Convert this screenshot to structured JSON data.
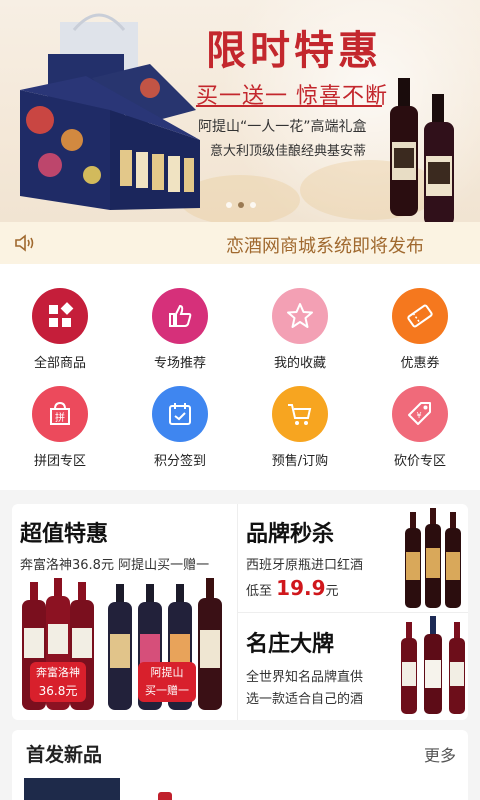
{
  "banner": {
    "title": "限时特惠",
    "subtitle": "买一送一 惊喜不断",
    "line2": "阿提山“一人一花”高端礼盒",
    "line3": "意大利顶级佳酿经典基安蒂"
  },
  "notice": {
    "text": "恋酒网商城系统即将发布",
    "icon": "speaker-icon"
  },
  "menu": [
    {
      "label": "全部商品",
      "icon": "grid-icon",
      "color": "#c51e3a"
    },
    {
      "label": "专场推荐",
      "icon": "thumbs-up-icon",
      "color": "#d6307a"
    },
    {
      "label": "我的收藏",
      "icon": "star-icon",
      "color": "#f3a0b4"
    },
    {
      "label": "优惠券",
      "icon": "coupon-icon",
      "color": "#f5781e"
    },
    {
      "label": "拼团专区",
      "icon": "group-buy-icon",
      "color": "#ec4a5c"
    },
    {
      "label": "积分签到",
      "icon": "calendar-icon",
      "color": "#3f86f0"
    },
    {
      "label": "预售/订购",
      "icon": "cart-icon",
      "color": "#f7a520"
    },
    {
      "label": "砍价专区",
      "icon": "price-tag-icon",
      "color": "#f06a7a"
    }
  ],
  "promo": {
    "left": {
      "title": "超值特惠",
      "sub": "奔富洛神36.8元 阿提山买一赠一",
      "tag1_line1": "奔富洛神",
      "tag1_line2": "36.8元",
      "tag2_line1": "阿提山",
      "tag2_line2": "买一赠一"
    },
    "right_top": {
      "title": "品牌秒杀",
      "sub": "西班牙原瓶进口红酒",
      "price_prefix": "低至",
      "price": "19.9",
      "price_suffix": "元"
    },
    "right_bottom": {
      "title": "名庄大牌",
      "sub1": "全世界知名品牌直供",
      "sub2": "选一款适合自己的酒"
    }
  },
  "new_products": {
    "title": "首发新品",
    "more": "更多"
  }
}
